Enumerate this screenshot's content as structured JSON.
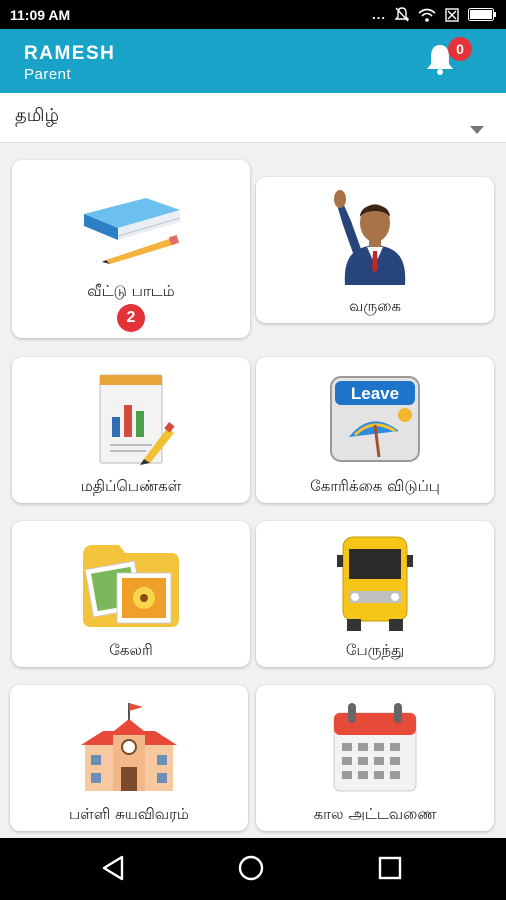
{
  "status_bar": {
    "time": "11:09 AM",
    "dots": "..."
  },
  "header": {
    "user_name": "RAMESH",
    "user_role": "Parent",
    "notification_count": "0"
  },
  "language": {
    "selected": "தமிழ்"
  },
  "tiles": [
    {
      "label": "வீட்டு பாடம்",
      "badge": "2",
      "icon": "book-pencil-icon"
    },
    {
      "label": "வருகை",
      "icon": "student-raising-hand-icon"
    },
    {
      "label": "மதிப்பெண்கள்",
      "icon": "report-chart-icon"
    },
    {
      "label": "கோரிக்கை விடுப்பு",
      "icon": "leave-calendar-icon",
      "icon_text": "Leave"
    },
    {
      "label": "கேலரி",
      "icon": "photo-folder-icon"
    },
    {
      "label": "பேருந்து",
      "icon": "school-bus-icon"
    },
    {
      "label": "பள்ளி சுயவிவரம்",
      "icon": "school-building-icon"
    },
    {
      "label": "கால அட்டவணை",
      "icon": "calendar-icon"
    }
  ],
  "colors": {
    "primary": "#1aa3c9",
    "badge": "#e43338",
    "background": "#f1f1f1"
  }
}
